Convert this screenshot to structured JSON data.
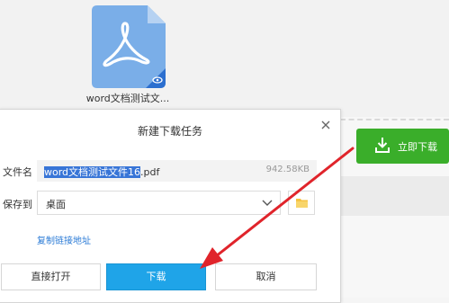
{
  "file_card": {
    "name": "word文档测试文..."
  },
  "dialog": {
    "title": "新建下载任务",
    "filename_label": "文件名",
    "filename_selected": "word文档测试文件16",
    "filename_ext": ".pdf",
    "file_size": "942.58KB",
    "save_label": "保存到",
    "save_value": "桌面",
    "copy_link": "复制链接地址",
    "btn_open": "直接打开",
    "btn_download": "下载",
    "btn_cancel": "取消"
  },
  "side": {
    "instant_download": "立即下载"
  },
  "colors": {
    "pdf_blue": "#7aaee8",
    "instant_green": "#3aae2a",
    "download_blue": "#1fa4e8",
    "arrow_red": "#e0242b"
  },
  "icons": [
    "pdf-file-icon",
    "eye-icon",
    "close-icon",
    "chevron-down-icon",
    "folder-icon",
    "download-icon",
    "red-arrow"
  ]
}
